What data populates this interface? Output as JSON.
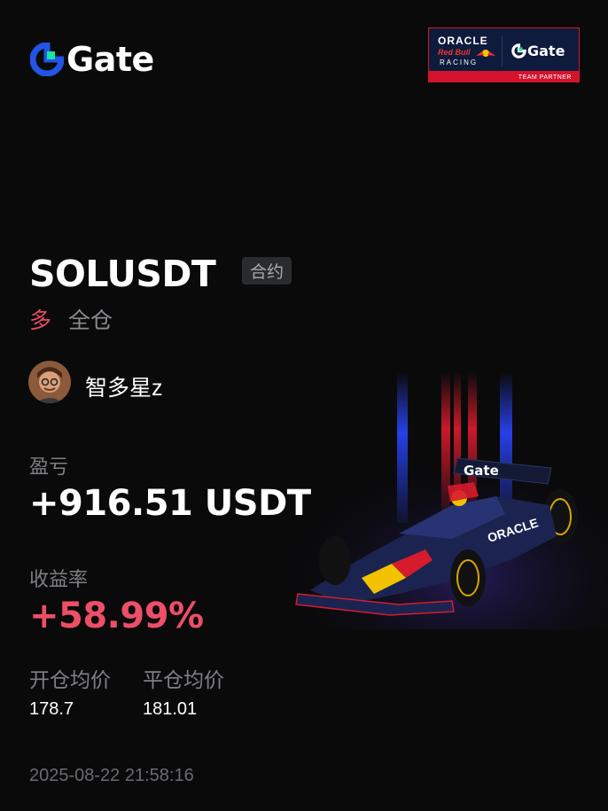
{
  "brand": {
    "name": "Gate",
    "accent": "#2354e6",
    "green": "#17e6a1"
  },
  "partner_badge": {
    "line1": "ORACLE",
    "line2": "Red Bull",
    "line3": "RACING",
    "gate": "Gate",
    "footer": "TEAM PARTNER"
  },
  "position": {
    "pair": "SOLUSDT",
    "type_tag": "合约",
    "direction": "多",
    "margin_mode": "全仓"
  },
  "user": {
    "name": "智多星z"
  },
  "pnl": {
    "label": "盈亏",
    "value": "+916.51 USDT"
  },
  "roi": {
    "label": "收益率",
    "value": "+58.99%"
  },
  "prices": {
    "open_label": "开仓均价",
    "open_value": "178.7",
    "close_label": "平仓均价",
    "close_value": "181.01"
  },
  "timestamp": "2025-08-22 21:58:16",
  "colors": {
    "positive": "#ec4f66",
    "muted": "#7f8085",
    "background": "#0a0a0b"
  }
}
